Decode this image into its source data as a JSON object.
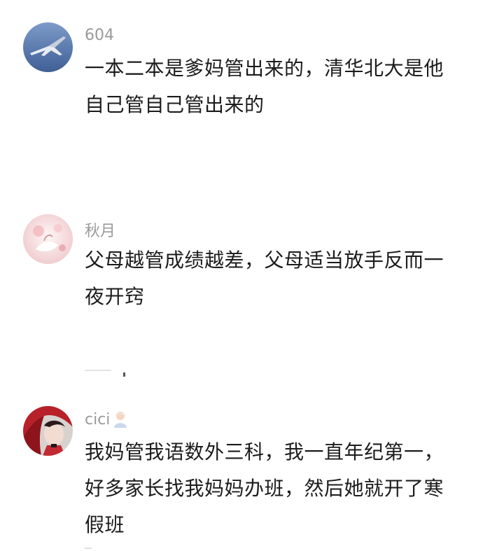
{
  "comments": [
    {
      "username": "604",
      "avatar_icon": "jet-airplane-avatar",
      "lines": [
        "一本二本是爹妈管出来的，清华北大是他",
        "自己管自己管出来的"
      ]
    },
    {
      "username": "秋月",
      "avatar_icon": "pink-flower-avatar",
      "lines": [
        "父母越管成绩越差，父母适当放手反而一",
        "夜开窍"
      ]
    },
    {
      "username": "cici",
      "badge_icon": "person-emoji-icon",
      "avatar_icon": "red-hood-character-avatar",
      "lines": [
        "我妈管我语数外三科，我一直年纪第一，",
        "好多家长找我妈妈办班，然后她就开了寒",
        "假班"
      ]
    }
  ]
}
